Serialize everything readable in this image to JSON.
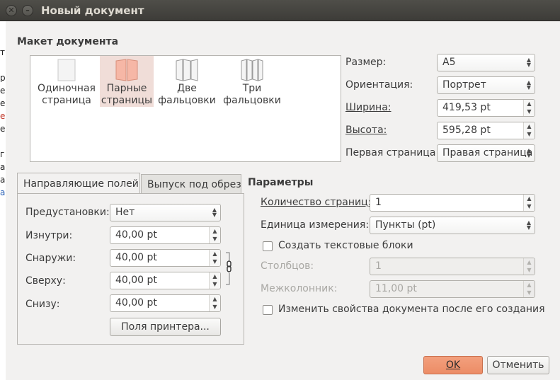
{
  "window": {
    "title": "Новый документ"
  },
  "layout_section": {
    "heading": "Макет документа",
    "options": [
      {
        "line1": "Одиночная",
        "line2": "страница",
        "selected": false
      },
      {
        "line1": "Парные",
        "line2": "страницы",
        "selected": true
      },
      {
        "line1": "Две",
        "line2": "фальцовки",
        "selected": false
      },
      {
        "line1": "Три",
        "line2": "фальцовки",
        "selected": false
      }
    ]
  },
  "page": {
    "size_label": "Размер:",
    "size_value": "A5",
    "orientation_label": "Ориентация:",
    "orientation_value": "Портрет",
    "width_label": "Ширина:",
    "width_value": "419,53  pt",
    "height_label": "Высота:",
    "height_value": "595,28  pt",
    "first_page_label": "Первая страница:",
    "first_page_value": "Правая страница"
  },
  "tabs": [
    {
      "label": "Направляющие полей",
      "active": true
    },
    {
      "label": "Выпуск под обрез",
      "active": false
    }
  ],
  "margins": {
    "preset_label": "Предустановки:",
    "preset_value": "Нет",
    "inside_label": "Изнутри:",
    "inside_value": "40,00  pt",
    "outside_label": "Снаружи:",
    "outside_value": "40,00  pt",
    "top_label": "Сверху:",
    "top_value": "40,00  pt",
    "bottom_label": "Снизу:",
    "bottom_value": "40,00  pt",
    "printer_button": "Поля принтера..."
  },
  "parameters": {
    "heading": "Параметры",
    "pages_label": "Количество страниц:",
    "pages_value": "1",
    "unit_label": "Единица измерения:",
    "unit_value": "Пункты (pt)",
    "create_frames_label": "Создать текстовые блоки",
    "create_frames_checked": false,
    "columns_label": "Столбцов:",
    "columns_value": "1",
    "gutter_label": "Межколонник:",
    "gutter_value": "11,00  pt",
    "change_props_label": "Изменить свойства документа после его создания",
    "change_props_checked": false
  },
  "buttons": {
    "ok": "OK",
    "cancel": "Отменить"
  },
  "colors": {
    "titlebar": "#45443f",
    "dialog_bg": "#f2f1f0",
    "accent": "#ec8c66",
    "selected_option": "#f0ddd8"
  },
  "icons": {
    "close": "close-icon",
    "minimize": "minimize-icon",
    "single_page": "single-page-icon",
    "facing_pages": "facing-pages-icon",
    "two_fold": "two-fold-icon",
    "three_fold": "three-fold-icon",
    "chain": "chain-link-icon"
  }
}
